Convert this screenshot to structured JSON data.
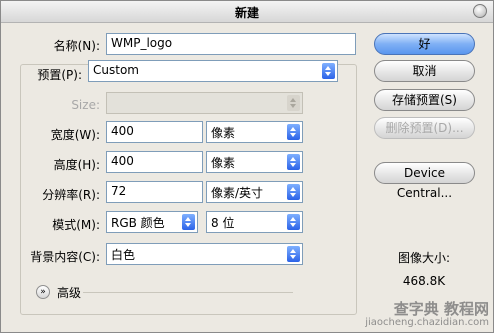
{
  "window": {
    "title": "新建"
  },
  "name": {
    "label": "名称(N):",
    "value": "WMP_logo"
  },
  "preset": {
    "label": "预置(P):",
    "value": "Custom"
  },
  "size": {
    "label": "Size:",
    "value": ""
  },
  "width": {
    "label": "宽度(W):",
    "value": "400",
    "unit": "像素"
  },
  "height": {
    "label": "高度(H):",
    "value": "400",
    "unit": "像素"
  },
  "resolution": {
    "label": "分辨率(R):",
    "value": "72",
    "unit": "像素/英寸"
  },
  "mode": {
    "label": "模式(M):",
    "value": "RGB 颜色",
    "depth": "8 位"
  },
  "background": {
    "label": "背景内容(C):",
    "value": "白色"
  },
  "advanced": {
    "label": "高级"
  },
  "buttons": {
    "ok": "好",
    "cancel": "取消",
    "save_preset": "存储预置(S)",
    "delete_preset": "删除预置(D)...",
    "device_central": "Device Central..."
  },
  "image_size": {
    "label": "图像大小:",
    "value": "468.8K"
  },
  "watermark": {
    "line1": "查字典 教程网",
    "line2": "jiaocheng.chazidian.com"
  },
  "colors": {
    "primary_button": "#7fb0f5",
    "spin_button": "#2c63e8"
  }
}
